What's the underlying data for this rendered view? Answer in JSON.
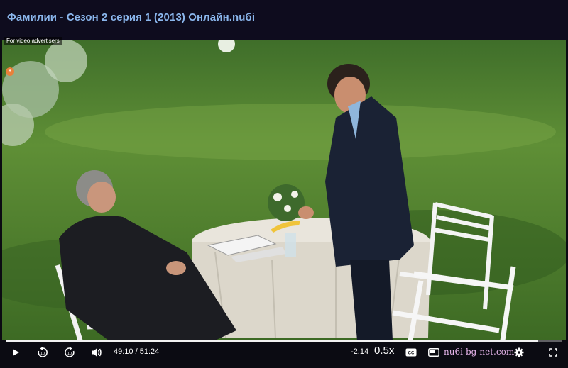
{
  "page": {
    "title": "Фамилии - Сезон 2 серия 1 (2013) Онлайн.nuбi"
  },
  "ad": {
    "label": "For video advertisers",
    "badge": "8"
  },
  "player": {
    "current_time": "49:10",
    "duration": "51:24",
    "separator": " / ",
    "remaining": "-2:14",
    "speed": "0.5x",
    "progress_fraction": 0.957,
    "watermark": "nu6i-bg-net.com",
    "accent_color": "#f2f2f2"
  },
  "icons": {
    "play": "play-icon",
    "rewind": "rewind-10-icon",
    "forward": "forward-10-icon",
    "volume": "volume-icon",
    "captions": "captions-icon",
    "pip": "picture-in-picture-icon",
    "settings": "gear-icon",
    "fullscreen": "fullscreen-icon"
  }
}
